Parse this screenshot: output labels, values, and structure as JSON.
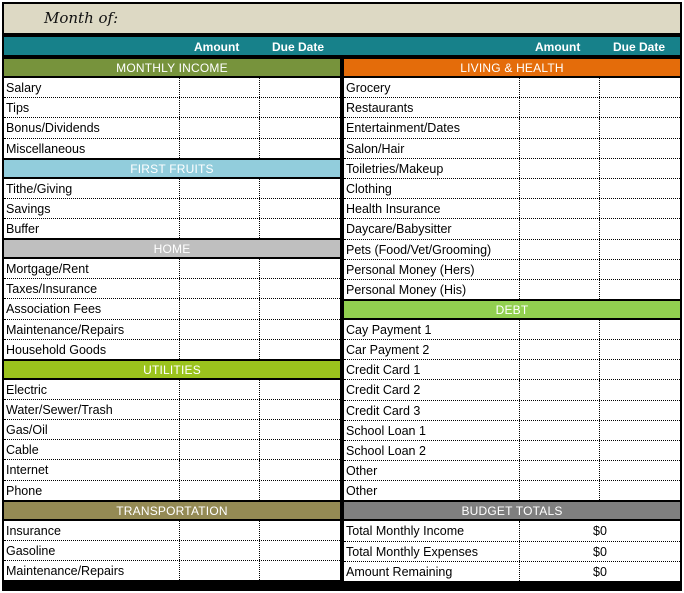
{
  "header": {
    "month_label": "Month of:",
    "amount_label": "Amount",
    "due_date_label": "Due Date"
  },
  "colors": {
    "month_bar": "#ddd9c4",
    "header_bar": "#17818a",
    "monthly_income": "#77933c",
    "first_fruits": "#92cddc",
    "home": "#bfbfbf",
    "utilities": "#9bc31d",
    "transportation": "#948a54",
    "living_health": "#e46c0a",
    "debt": "#92d050",
    "budget_totals": "#7f7f7f"
  },
  "left_sections": [
    {
      "title": "MONTHLY INCOME",
      "items": [
        "Salary",
        "Tips",
        "Bonus/Dividends",
        "Miscellaneous"
      ]
    },
    {
      "title": "FIRST FRUITS",
      "items": [
        "Tithe/Giving",
        "Savings",
        "Buffer"
      ]
    },
    {
      "title": "HOME",
      "items": [
        "Mortgage/Rent",
        "Taxes/Insurance",
        "Association Fees",
        "Maintenance/Repairs",
        "Household Goods"
      ]
    },
    {
      "title": "UTILITIES",
      "items": [
        "Electric",
        "Water/Sewer/Trash",
        "Gas/Oil",
        "Cable",
        "Internet",
        "Phone"
      ]
    },
    {
      "title": "TRANSPORTATION",
      "items": [
        "Insurance",
        "Gasoline",
        "Maintenance/Repairs"
      ]
    }
  ],
  "right_sections": [
    {
      "title": "LIVING & HEALTH",
      "items": [
        "Grocery",
        "Restaurants",
        "Entertainment/Dates",
        "Salon/Hair",
        "Toiletries/Makeup",
        "Clothing",
        "Health Insurance",
        "Daycare/Babysitter",
        "Pets (Food/Vet/Grooming)",
        "Personal Money (Hers)",
        "Personal Money (His)"
      ]
    },
    {
      "title": "DEBT",
      "items": [
        "Cay Payment 1",
        "Car Payment 2",
        "Credit Card 1",
        "Credit Card 2",
        "Credit Card 3",
        "School Loan 1",
        "School Loan 2",
        "Other",
        "Other"
      ]
    }
  ],
  "budget_totals": {
    "title": "BUDGET TOTALS",
    "rows": [
      {
        "label": "Total Monthly Income",
        "value": "$0"
      },
      {
        "label": "Total Monthly Expenses",
        "value": "$0"
      },
      {
        "label": "Amount Remaining",
        "value": "$0"
      }
    ]
  }
}
